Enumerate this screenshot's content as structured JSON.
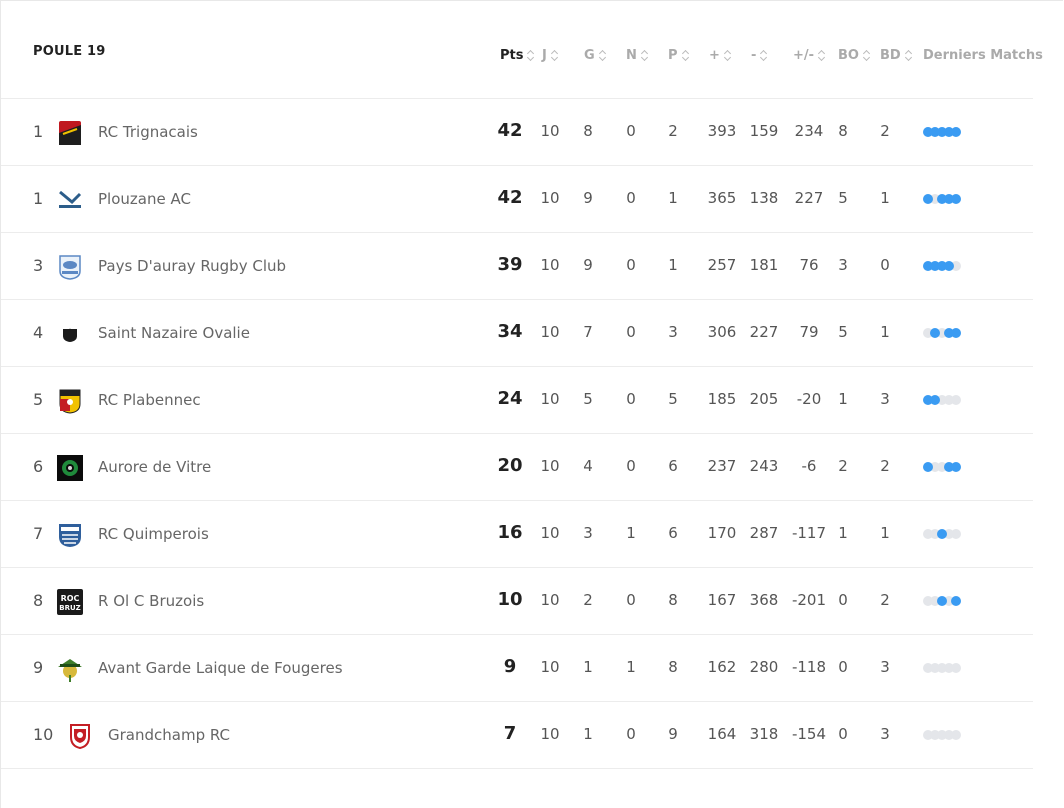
{
  "poule_title": "POULE 19",
  "columns": [
    {
      "key": "pts",
      "label": "Pts",
      "active": true
    },
    {
      "key": "j",
      "label": "J"
    },
    {
      "key": "g",
      "label": "G"
    },
    {
      "key": "n",
      "label": "N"
    },
    {
      "key": "p",
      "label": "P"
    },
    {
      "key": "plus",
      "label": "+"
    },
    {
      "key": "minus",
      "label": "-"
    },
    {
      "key": "diff",
      "label": "+/-"
    },
    {
      "key": "bo",
      "label": "BO"
    },
    {
      "key": "bd",
      "label": "BD"
    },
    {
      "key": "form",
      "label": "Derniers Matchs"
    }
  ],
  "colors": {
    "win": "#3a9bf2",
    "loss": "#e4e6ea"
  },
  "rows": [
    {
      "rank": "1",
      "team": "RC Trignacais",
      "logo": "rc-trignacais-logo",
      "pts": "42",
      "j": "10",
      "g": "8",
      "n": "0",
      "p": "2",
      "plus": "393",
      "minus": "159",
      "diff": "234",
      "bo": "8",
      "bd": "2",
      "form": [
        "w",
        "w",
        "w",
        "w",
        "w"
      ]
    },
    {
      "rank": "1",
      "team": "Plouzane AC",
      "logo": "plouzane-ac-logo",
      "pts": "42",
      "j": "10",
      "g": "9",
      "n": "0",
      "p": "1",
      "plus": "365",
      "minus": "138",
      "diff": "227",
      "bo": "5",
      "bd": "1",
      "form": [
        "w",
        "l",
        "w",
        "w",
        "w"
      ]
    },
    {
      "rank": "3",
      "team": "Pays D'auray Rugby Club",
      "logo": "pays-dauray-logo",
      "pts": "39",
      "j": "10",
      "g": "9",
      "n": "0",
      "p": "1",
      "plus": "257",
      "minus": "181",
      "diff": "76",
      "bo": "3",
      "bd": "0",
      "form": [
        "w",
        "w",
        "w",
        "w",
        "l"
      ]
    },
    {
      "rank": "4",
      "team": "Saint Nazaire Ovalie",
      "logo": "saint-nazaire-logo",
      "pts": "34",
      "j": "10",
      "g": "7",
      "n": "0",
      "p": "3",
      "plus": "306",
      "minus": "227",
      "diff": "79",
      "bo": "5",
      "bd": "1",
      "form": [
        "l",
        "w",
        "l",
        "w",
        "w"
      ]
    },
    {
      "rank": "5",
      "team": "RC Plabennec",
      "logo": "rc-plabennec-logo",
      "pts": "24",
      "j": "10",
      "g": "5",
      "n": "0",
      "p": "5",
      "plus": "185",
      "minus": "205",
      "diff": "-20",
      "bo": "1",
      "bd": "3",
      "form": [
        "w",
        "w",
        "l",
        "l",
        "l"
      ]
    },
    {
      "rank": "6",
      "team": "Aurore de Vitre",
      "logo": "aurore-vitre-logo",
      "pts": "20",
      "j": "10",
      "g": "4",
      "n": "0",
      "p": "6",
      "plus": "237",
      "minus": "243",
      "diff": "-6",
      "bo": "2",
      "bd": "2",
      "form": [
        "w",
        "l",
        "l",
        "w",
        "w"
      ]
    },
    {
      "rank": "7",
      "team": "RC Quimperois",
      "logo": "rc-quimperois-logo",
      "pts": "16",
      "j": "10",
      "g": "3",
      "n": "1",
      "p": "6",
      "plus": "170",
      "minus": "287",
      "diff": "-117",
      "bo": "1",
      "bd": "1",
      "form": [
        "l",
        "l",
        "w",
        "l",
        "l"
      ]
    },
    {
      "rank": "8",
      "team": "R Ol C Bruzois",
      "logo": "roc-bruz-logo",
      "pts": "10",
      "j": "10",
      "g": "2",
      "n": "0",
      "p": "8",
      "plus": "167",
      "minus": "368",
      "diff": "-201",
      "bo": "0",
      "bd": "2",
      "form": [
        "l",
        "l",
        "w",
        "l",
        "w"
      ]
    },
    {
      "rank": "9",
      "team": "Avant Garde Laique de Fougeres",
      "logo": "agl-fougeres-logo",
      "pts": "9",
      "j": "10",
      "g": "1",
      "n": "1",
      "p": "8",
      "plus": "162",
      "minus": "280",
      "diff": "-118",
      "bo": "0",
      "bd": "3",
      "form": [
        "l",
        "l",
        "l",
        "l",
        "l"
      ]
    },
    {
      "rank": "10",
      "team": "Grandchamp RC",
      "logo": "grandchamp-rc-logo",
      "pts": "7",
      "j": "10",
      "g": "1",
      "n": "0",
      "p": "9",
      "plus": "164",
      "minus": "318",
      "diff": "-154",
      "bo": "0",
      "bd": "3",
      "form": [
        "l",
        "l",
        "l",
        "l",
        "l"
      ]
    }
  ]
}
